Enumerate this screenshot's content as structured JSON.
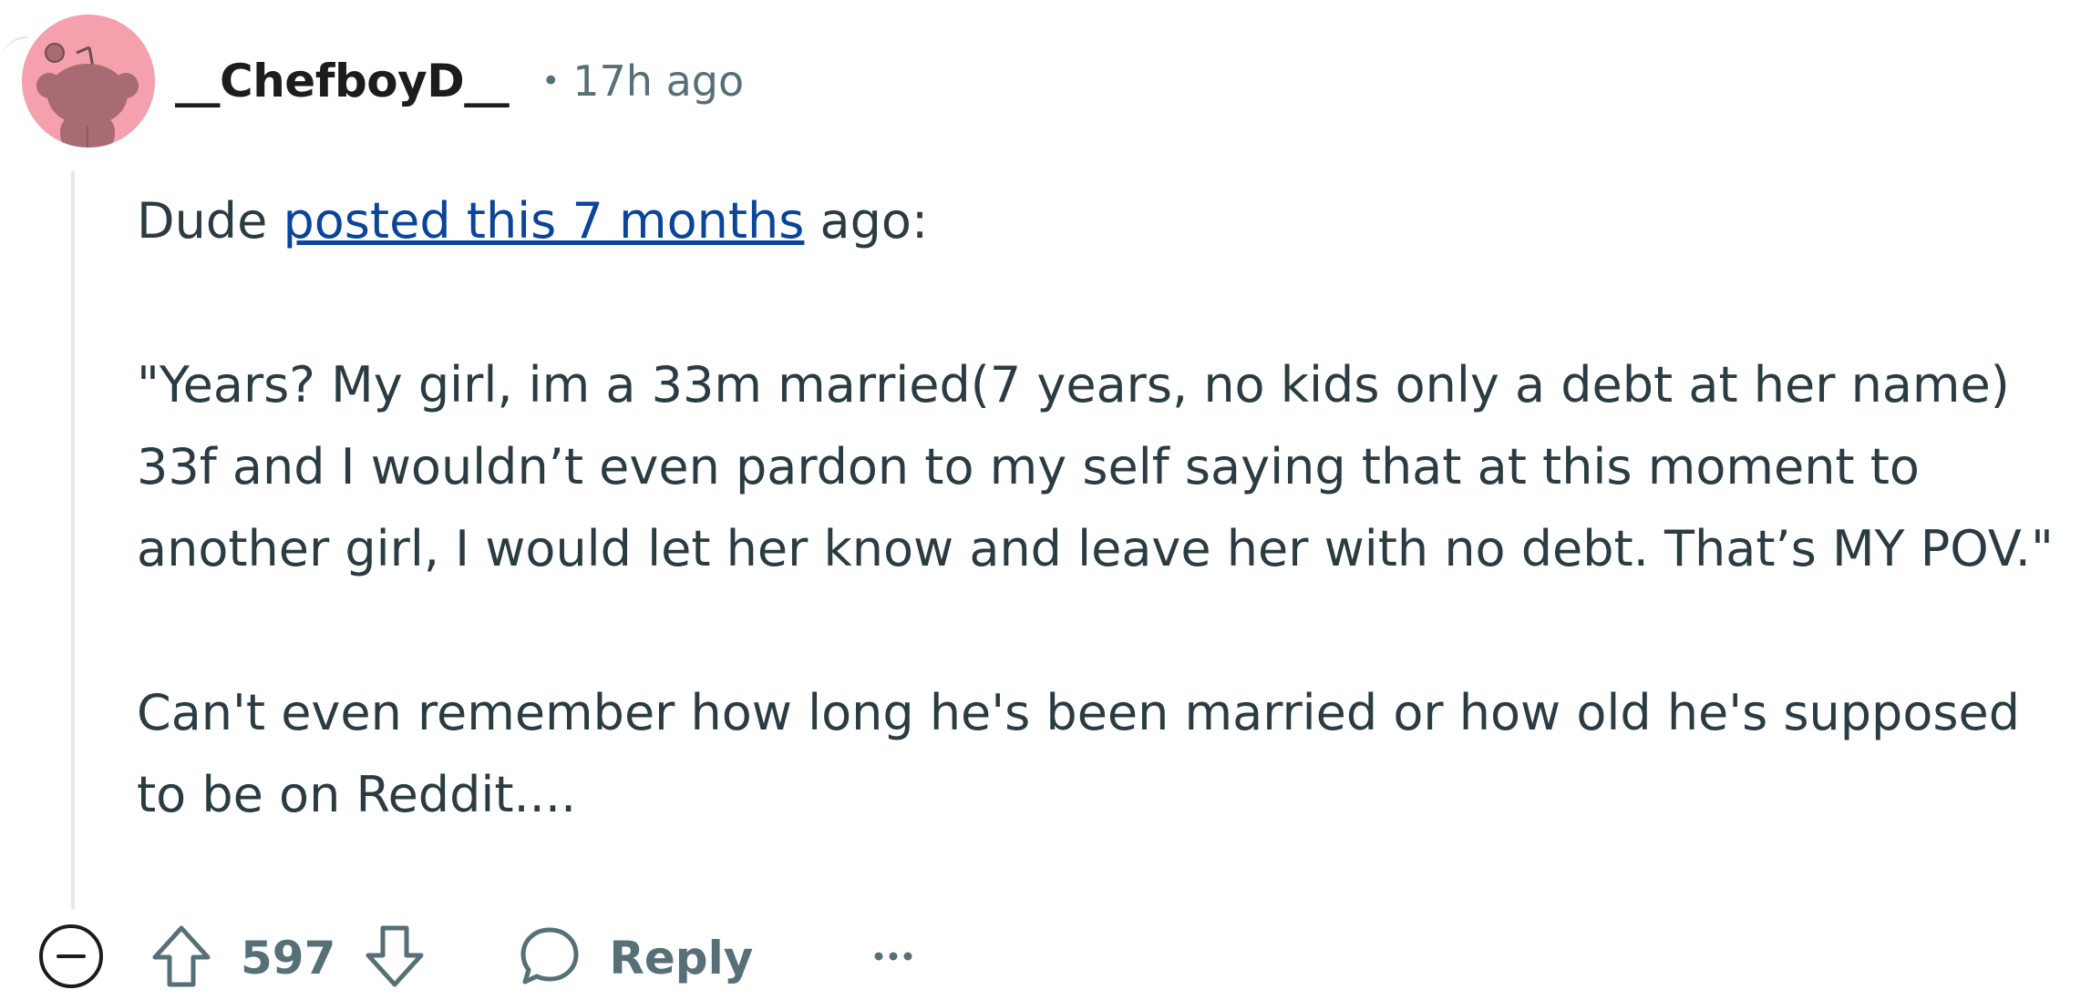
{
  "comment": {
    "author": "__ChefboyD__",
    "separator": "•",
    "time_ago": "17h ago",
    "body": {
      "line1_prefix": "Dude ",
      "line1_link": "posted this 7 months",
      "line1_suffix": " ago:",
      "quote": "\"Years? My girl, im a 33m married(7 years, no kids only a debt at her name) 33f and I wouldn’t even pardon to my self saying that at this moment to another girl, I would let her know and leave her with no debt. That’s MY POV.\"",
      "closing": "Can't even remember how long he's been married or how old he's supposed to be on Reddit...."
    }
  },
  "actions": {
    "score": "597",
    "reply_label": "Reply"
  },
  "colors": {
    "avatar_bg": "#f5a0ad",
    "link": "#0a449b",
    "meta_text": "#576f76",
    "body_text": "#2a3c42"
  },
  "icons": {
    "avatar": "snoo-avatar-icon",
    "collapse": "collapse-minus-icon",
    "upvote": "upvote-arrow-icon",
    "downvote": "downvote-arrow-icon",
    "reply": "speech-bubble-icon",
    "more": "more-options-icon"
  }
}
